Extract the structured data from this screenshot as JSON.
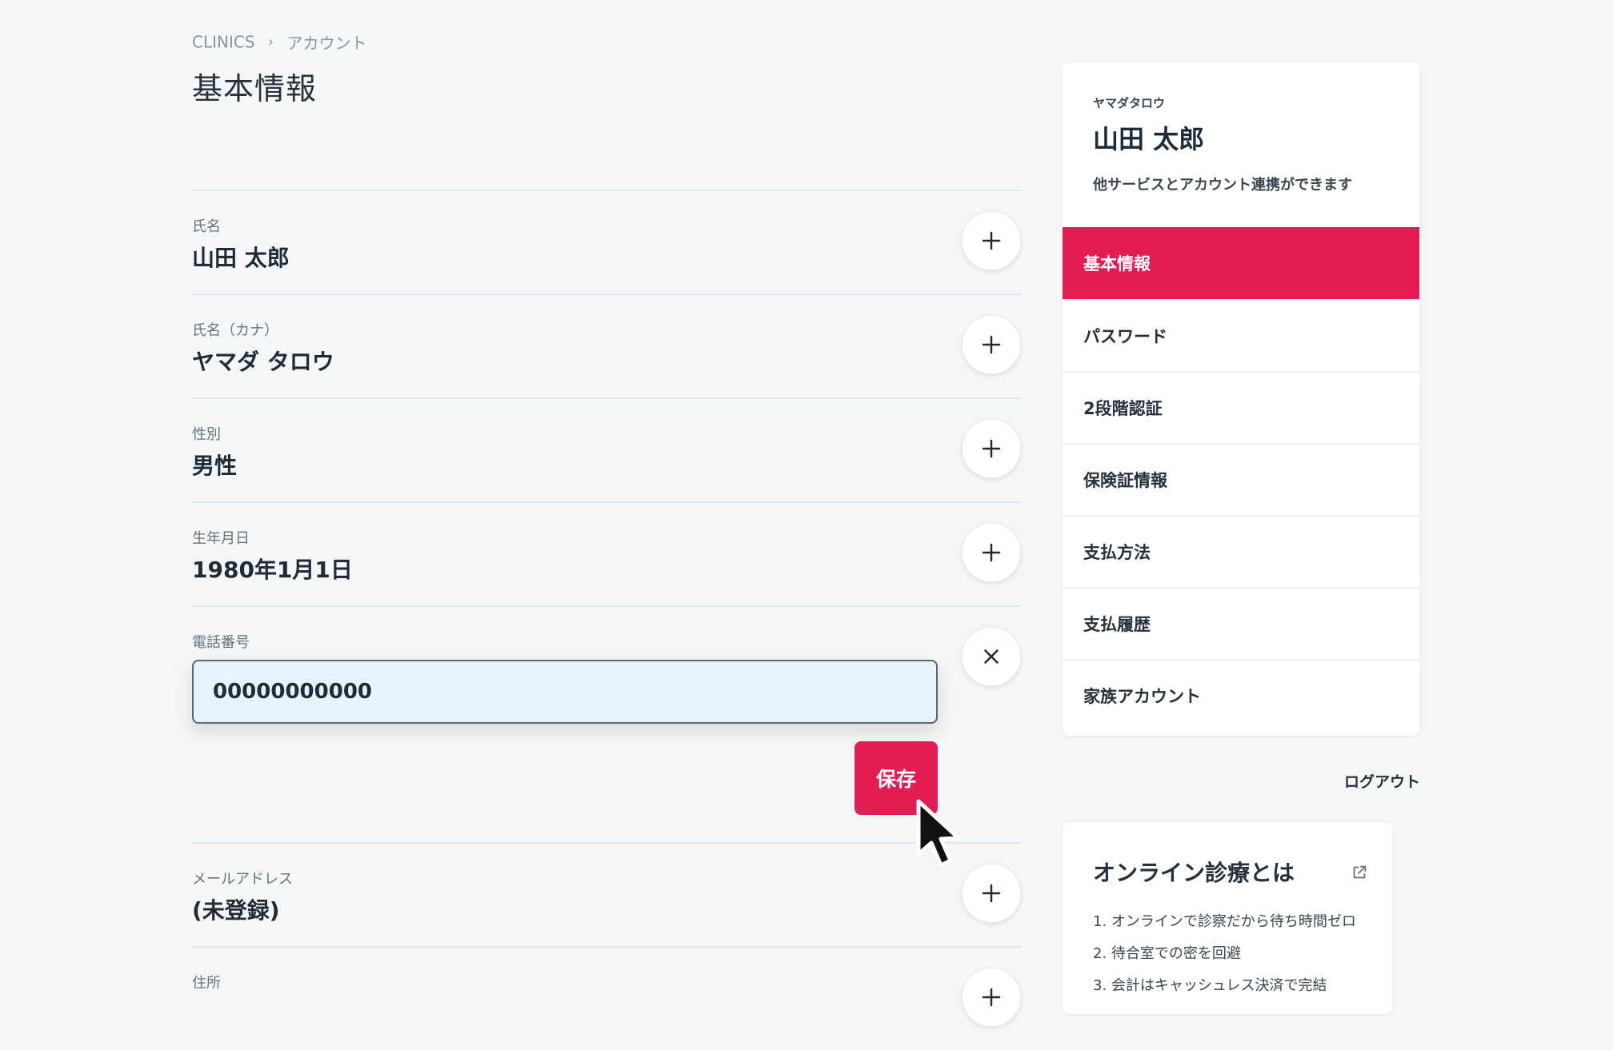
{
  "breadcrumb": {
    "root": "CLINICS",
    "sep": "›",
    "current": "アカウント"
  },
  "page": {
    "title": "基本情報"
  },
  "fields": [
    {
      "label": "氏名",
      "value": "山田 太郎"
    },
    {
      "label": "氏名（カナ）",
      "value": "ヤマダ タロウ"
    },
    {
      "label": "性別",
      "value": "男性"
    },
    {
      "label": "生年月日",
      "value": "1980年1月1日"
    }
  ],
  "phone": {
    "label": "電話番号",
    "value": "00000000000",
    "save_label": "保存"
  },
  "fields_after": [
    {
      "label": "メールアドレス",
      "value": "(未登録)"
    },
    {
      "label": "住所",
      "value": ""
    }
  ],
  "profile": {
    "kana": "ヤマダタロウ",
    "name": "山田 太郎",
    "desc": "他サービスとアカウント連携ができます"
  },
  "nav": [
    {
      "label": "基本情報"
    },
    {
      "label": "パスワード"
    },
    {
      "label": "2段階認証"
    },
    {
      "label": "保険証情報"
    },
    {
      "label": "支払方法"
    },
    {
      "label": "支払履歴"
    },
    {
      "label": "家族アカウント"
    }
  ],
  "logout_label": "ログアウト",
  "info": {
    "title": "オンライン診療とは",
    "items": [
      "1. オンラインで診察だから待ち時間ゼロ",
      "2. 待合室での密を回避",
      "3. 会計はキャッシュレス決済で完結"
    ]
  },
  "colors": {
    "accent": "#e31c53",
    "input_bg": "#e8f1fe",
    "background": "#f4f6f8"
  },
  "icons": {
    "add": "plus-icon",
    "close": "close-icon",
    "external": "external-link-icon"
  }
}
